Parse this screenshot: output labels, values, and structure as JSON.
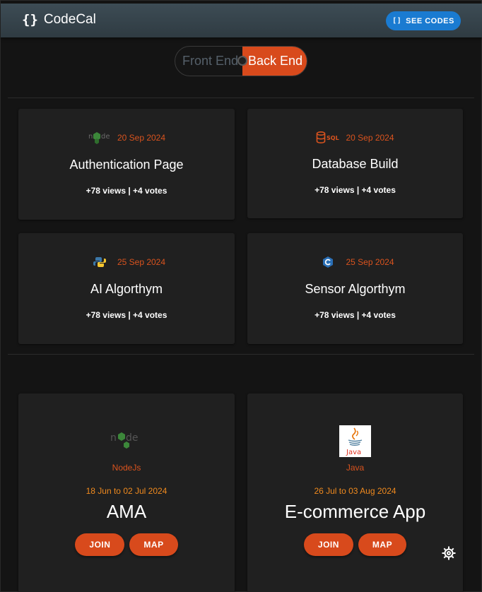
{
  "header": {
    "brand_icon": "{}",
    "brand_name": "CodeCal",
    "see_codes_icon": "[]",
    "see_codes_label": "SEE CODES"
  },
  "toggle": {
    "front_label": "Front End",
    "back_label": "Back End",
    "active": "Back End"
  },
  "projects": [
    {
      "icon": "nodejs-icon",
      "date": "20 Sep 2024",
      "title": "Authentication Page",
      "stats": "+78 views | +4 votes"
    },
    {
      "icon": "sql-database-icon",
      "date": "20 Sep 2024",
      "title": "Database Build",
      "stats": "+78 views | +4 votes"
    },
    {
      "icon": "python-icon",
      "date": "25 Sep 2024",
      "title": "AI Algorthym",
      "stats": "+78 views | +4 votes"
    },
    {
      "icon": "c-language-icon",
      "date": "25 Sep 2024",
      "title": "Sensor Algorthym",
      "stats": "+78 views | +4 votes"
    }
  ],
  "events": [
    {
      "icon": "nodejs-logo",
      "tech": "NodeJs",
      "range": "18 Jun to 02 Jul 2024",
      "title": "AMA",
      "join_label": "JOIN",
      "map_label": "MAP"
    },
    {
      "icon": "java-logo",
      "tech": "Java",
      "range": "26 Jul to 03 Aug 2024",
      "title": "E-commerce App",
      "join_label": "JOIN",
      "map_label": "MAP"
    }
  ],
  "colors": {
    "accent": "#d84a1c",
    "date": "#d9531e",
    "range": "#f08a1e",
    "primary_button": "#1a7bd1",
    "card_bg": "#202020",
    "page_bg": "#141414",
    "header_bg": "#36444c"
  }
}
